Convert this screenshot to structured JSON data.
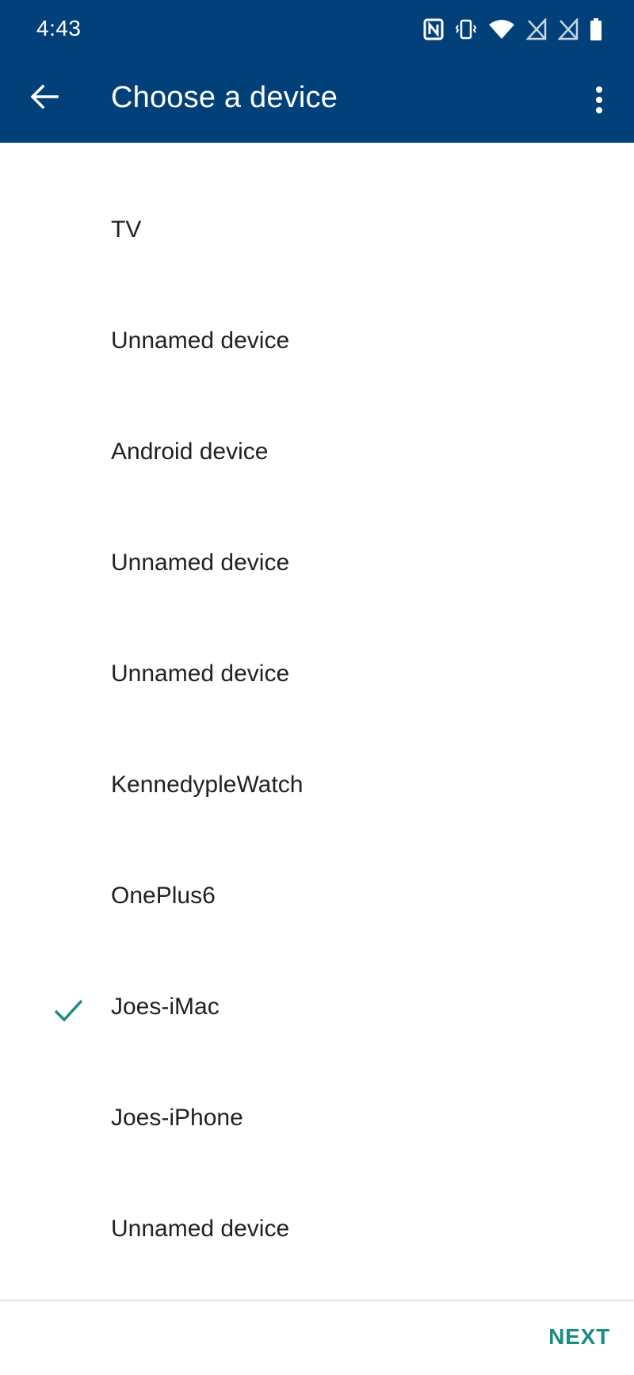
{
  "status_bar": {
    "time": "4:43",
    "icons": [
      "nfc-icon",
      "vibrate-icon",
      "wifi-icon",
      "no-sim-icon",
      "no-sim-icon",
      "battery-icon"
    ]
  },
  "app_bar": {
    "title": "Choose a device",
    "back_icon": "arrow-back-icon",
    "menu_icon": "more-vert-icon",
    "background": "#02407a"
  },
  "devices": [
    {
      "label": "TV",
      "selected": false
    },
    {
      "label": "Unnamed device",
      "selected": false
    },
    {
      "label": "Android device",
      "selected": false
    },
    {
      "label": "Unnamed device",
      "selected": false
    },
    {
      "label": "Unnamed device",
      "selected": false
    },
    {
      "label": "KennedypleWatch",
      "selected": false
    },
    {
      "label": "OnePlus6",
      "selected": false
    },
    {
      "label": "Joes-iMac",
      "selected": true
    },
    {
      "label": "Joes-iPhone",
      "selected": false
    },
    {
      "label": "Unnamed device",
      "selected": false
    }
  ],
  "footer": {
    "next_label": "NEXT",
    "accent": "#1a8e82"
  }
}
